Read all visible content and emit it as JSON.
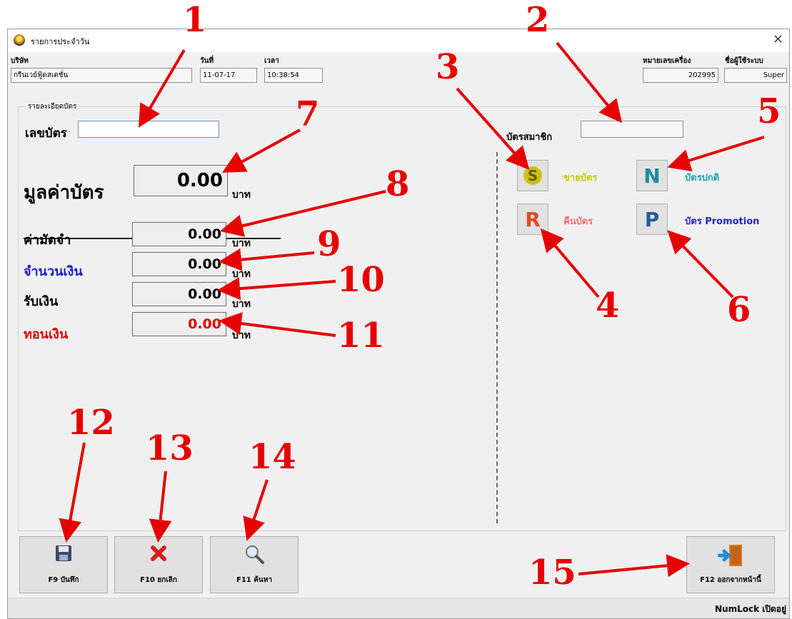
{
  "window": {
    "title": "รายการประจำวัน",
    "close_glyph": "×"
  },
  "header": {
    "company_label": "บริษัท",
    "company_value": "กรีนเวย์ฟู้ดสเตชั่น",
    "date_label": "วันที่",
    "date_value": "11-07-17",
    "time_label": "เวลา",
    "time_value": "10:38:54",
    "machine_label": "หมายเลขเครื่อง",
    "machine_value": "202995",
    "user_label": "ชื่อผู้ใช้ระบบ",
    "user_value": "Super"
  },
  "card_details": {
    "group_title": "รายละเอียดบัตร",
    "card_no_label": "เลขบัตร",
    "card_no_value": "",
    "card_value_label": "มูลค่าบัตร",
    "card_value": "0.00",
    "card_value_unit": "บาท",
    "deposit_label": "ค่ามัดจำ",
    "deposit_value": "0.00",
    "deposit_unit": "บาท",
    "amount_label": "จำนวนเงิน",
    "amount_value": "0.00",
    "amount_unit": "บาท",
    "received_label": "รับเงิน",
    "received_value": "0.00",
    "received_unit": "บาท",
    "change_label": "ทอนเงิน",
    "change_value": "0.00",
    "change_unit": "บาท"
  },
  "member": {
    "member_label": "บัตรสมาชิก",
    "member_value": "",
    "tiles": [
      {
        "letter": "S",
        "label": "ขายบัตร",
        "icon": "sell-card-icon",
        "label_color": "#c8c800",
        "icon_color": "#c9c21a"
      },
      {
        "letter": "N",
        "label": "บัตรปกติ",
        "icon": "normal-card-icon",
        "label_color": "#1aa6a6",
        "icon_color": "#1c8f9a"
      },
      {
        "letter": "R",
        "label": "คืนบัตร",
        "icon": "return-card-icon",
        "label_color": "#ff6b6b",
        "icon_color": "#e04a2a"
      },
      {
        "letter": "P",
        "label": "บัตร Promotion",
        "icon": "promotion-card-icon",
        "label_color": "#2323c8",
        "icon_color": "#1f5fa0"
      }
    ]
  },
  "buttons": {
    "save": "F9 บันทึก",
    "cancel": "F10 ยกเลิก",
    "search": "F11 ค้นหา",
    "exit": "F12 ออกจากหน้านี้"
  },
  "status": {
    "numlock": "NumLock เปิดอยู่"
  },
  "annotations": [
    "1",
    "2",
    "3",
    "4",
    "5",
    "6",
    "7",
    "8",
    "9",
    "10",
    "11",
    "12",
    "13",
    "14",
    "15"
  ],
  "colors": {
    "annotation": "#e60000",
    "amount_label": "#1a1ad6",
    "change_red": "#e00000"
  }
}
